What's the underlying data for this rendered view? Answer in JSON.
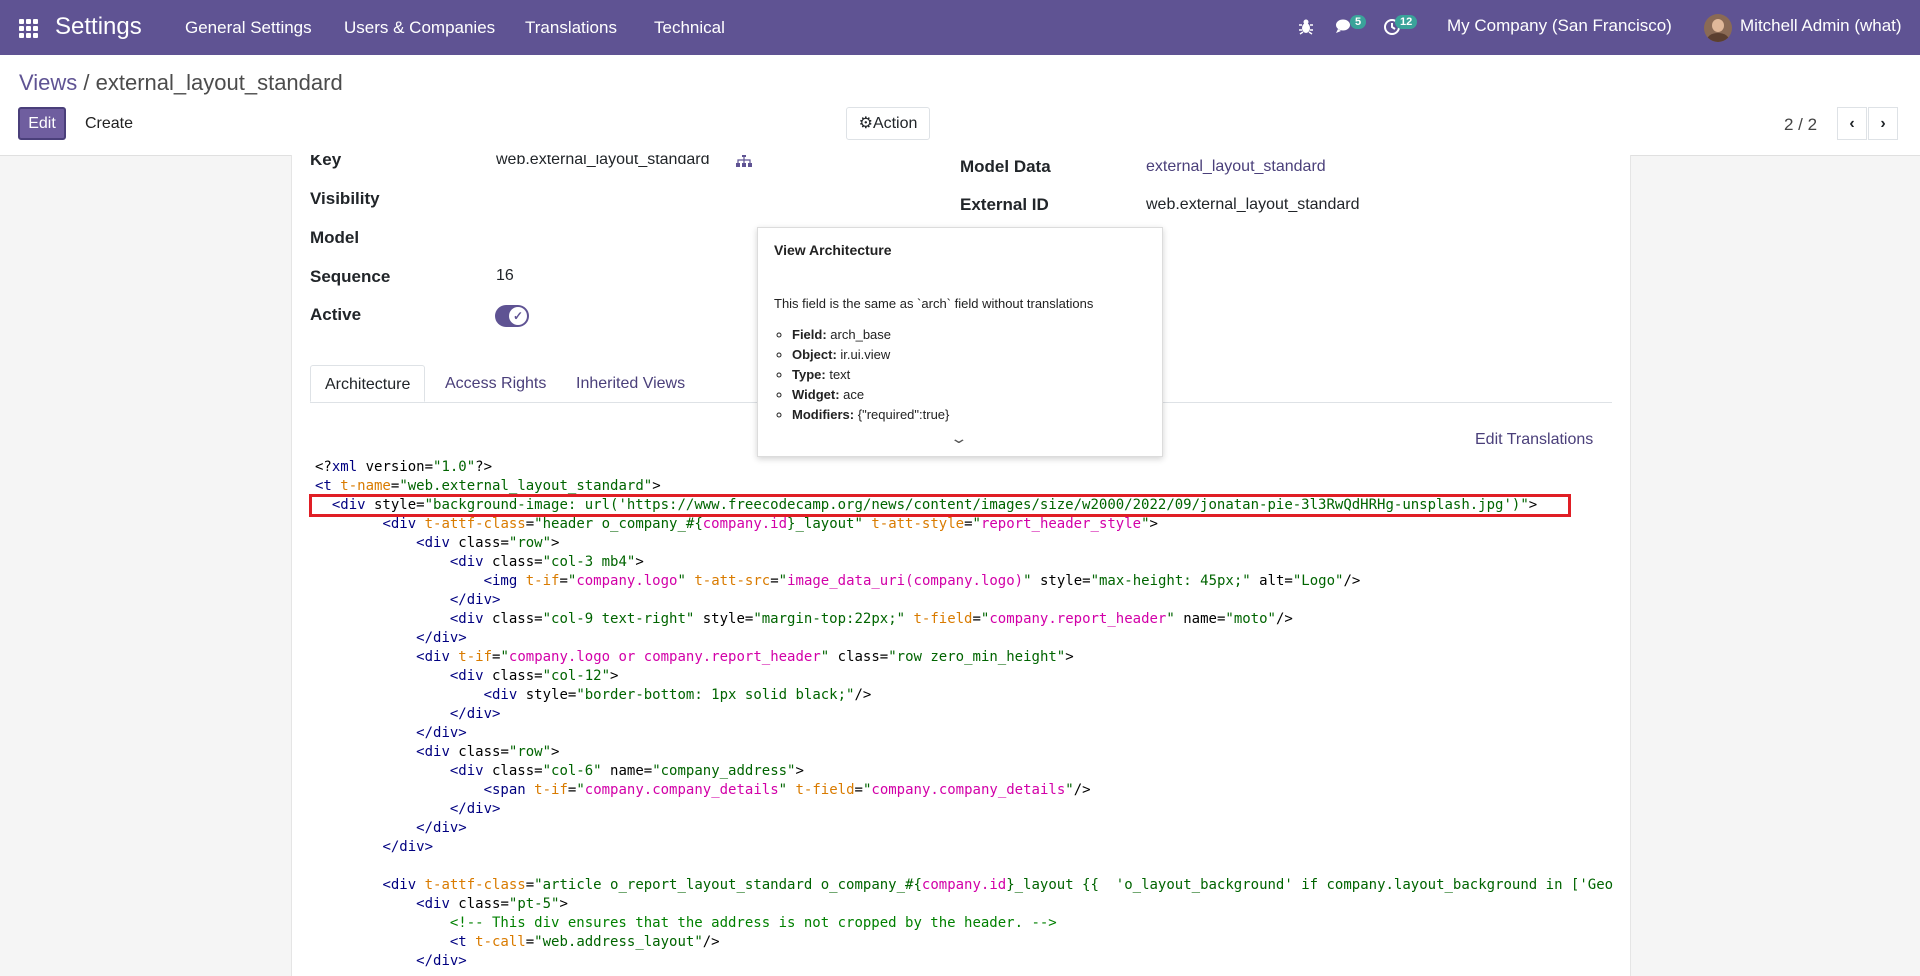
{
  "nav": {
    "brand": "Settings",
    "menu": [
      "General Settings",
      "Users & Companies",
      "Translations",
      "Technical"
    ],
    "messages_count": "5",
    "activities_count": "12",
    "company": "My Company (San Francisco)",
    "user": "Mitchell Admin (what)"
  },
  "control_panel": {
    "breadcrumb_parent": "Views",
    "breadcrumb_separator": " / ",
    "breadcrumb_current": "external_layout_standard",
    "edit_label": "Edit",
    "create_label": "Create",
    "action_label": "Action",
    "pager": "2 / 2"
  },
  "form": {
    "key_label": "Key",
    "key_value": "web.external_layout_standard",
    "visibility_label": "Visibility",
    "model_label": "Model",
    "sequence_label": "Sequence",
    "sequence_value": "16",
    "active_label": "Active",
    "model_data_label": "Model Data",
    "model_data_value": "external_layout_standard",
    "external_id_label": "External ID",
    "external_id_value": "web.external_layout_standard"
  },
  "tabs": [
    "Architecture",
    "Access Rights",
    "Inherited Views"
  ],
  "edit_translations": "Edit Translations",
  "tooltip": {
    "title": "View Architecture",
    "description": "This field is the same as `arch` field without translations",
    "items": [
      {
        "k": "Field:",
        "v": "arch_base"
      },
      {
        "k": "Object:",
        "v": "ir.ui.view"
      },
      {
        "k": "Type:",
        "v": "text"
      },
      {
        "k": "Widget:",
        "v": "ace"
      },
      {
        "k": "Modifiers:",
        "v": "{\"required\":true}"
      }
    ]
  },
  "code_lines": [
    [
      [
        "",
        "<?"
      ],
      [
        "tg",
        "xml"
      ],
      [
        "at",
        " version="
      ],
      [
        "st",
        "\"1.0\""
      ],
      [
        "",
        "?>"
      ]
    ],
    [
      [
        "tg",
        "<t"
      ],
      [
        "ta",
        " t-name"
      ],
      [
        "",
        "="
      ],
      [
        "st",
        "\"web.external_layout_standard\""
      ],
      [
        "",
        ">"
      ]
    ],
    [
      [
        "",
        "  "
      ],
      [
        "tg",
        "<div"
      ],
      [
        "at",
        " style="
      ],
      [
        "st",
        "\"background-image: url('https://www.freecodecamp.org/news/content/images/size/w2000/2022/09/jonatan-pie-3l3RwQdHRHg-unsplash.jpg')\""
      ],
      [
        "",
        ">"
      ]
    ],
    [
      [
        "",
        "        "
      ],
      [
        "tg",
        "<div"
      ],
      [
        "ta",
        " t-attf-class"
      ],
      [
        "",
        "="
      ],
      [
        "st",
        "\"header o_company_#{"
      ],
      [
        "qv",
        "company.id"
      ],
      [
        "st",
        "}_layout\""
      ],
      [
        "ta",
        " t-att-style"
      ],
      [
        "",
        "="
      ],
      [
        "st",
        "\""
      ],
      [
        "qv",
        "report_header_style"
      ],
      [
        "st",
        "\""
      ],
      [
        "",
        ">"
      ]
    ],
    [
      [
        "",
        "            "
      ],
      [
        "tg",
        "<div"
      ],
      [
        "at",
        " class="
      ],
      [
        "st",
        "\"row\""
      ],
      [
        "",
        ">"
      ]
    ],
    [
      [
        "",
        "                "
      ],
      [
        "tg",
        "<div"
      ],
      [
        "at",
        " class="
      ],
      [
        "st",
        "\"col-3 mb4\""
      ],
      [
        "",
        ">"
      ]
    ],
    [
      [
        "",
        "                    "
      ],
      [
        "tg",
        "<img"
      ],
      [
        "ta",
        " t-if"
      ],
      [
        "",
        "="
      ],
      [
        "st",
        "\""
      ],
      [
        "qv",
        "company.logo"
      ],
      [
        "st",
        "\""
      ],
      [
        "ta",
        " t-att-src"
      ],
      [
        "",
        "="
      ],
      [
        "st",
        "\""
      ],
      [
        "qv",
        "image_data_uri(company.logo)"
      ],
      [
        "st",
        "\""
      ],
      [
        "at",
        " style="
      ],
      [
        "st",
        "\"max-height: 45px;\""
      ],
      [
        "at",
        " alt="
      ],
      [
        "st",
        "\"Logo\""
      ],
      [
        "",
        "/>"
      ]
    ],
    [
      [
        "",
        "                "
      ],
      [
        "tg",
        "</div>"
      ]
    ],
    [
      [
        "",
        "                "
      ],
      [
        "tg",
        "<div"
      ],
      [
        "at",
        " class="
      ],
      [
        "st",
        "\"col-9 text-right\""
      ],
      [
        "at",
        " style="
      ],
      [
        "st",
        "\"margin-top:22px;\""
      ],
      [
        "ta",
        " t-field"
      ],
      [
        "",
        "="
      ],
      [
        "st",
        "\""
      ],
      [
        "qv",
        "company.report_header"
      ],
      [
        "st",
        "\""
      ],
      [
        "at",
        " name="
      ],
      [
        "st",
        "\"moto\""
      ],
      [
        "",
        "/>"
      ]
    ],
    [
      [
        "",
        "            "
      ],
      [
        "tg",
        "</div>"
      ]
    ],
    [
      [
        "",
        "            "
      ],
      [
        "tg",
        "<div"
      ],
      [
        "ta",
        " t-if"
      ],
      [
        "",
        "="
      ],
      [
        "st",
        "\""
      ],
      [
        "qv",
        "company.logo or company.report_header"
      ],
      [
        "st",
        "\""
      ],
      [
        "at",
        " class="
      ],
      [
        "st",
        "\"row zero_min_height\""
      ],
      [
        "",
        ">"
      ]
    ],
    [
      [
        "",
        "                "
      ],
      [
        "tg",
        "<div"
      ],
      [
        "at",
        " class="
      ],
      [
        "st",
        "\"col-12\""
      ],
      [
        "",
        ">"
      ]
    ],
    [
      [
        "",
        "                    "
      ],
      [
        "tg",
        "<div"
      ],
      [
        "at",
        " style="
      ],
      [
        "st",
        "\"border-bottom: 1px solid black;\""
      ],
      [
        "",
        "/>"
      ]
    ],
    [
      [
        "",
        "                "
      ],
      [
        "tg",
        "</div>"
      ]
    ],
    [
      [
        "",
        "            "
      ],
      [
        "tg",
        "</div>"
      ]
    ],
    [
      [
        "",
        "            "
      ],
      [
        "tg",
        "<div"
      ],
      [
        "at",
        " class="
      ],
      [
        "st",
        "\"row\""
      ],
      [
        "",
        ">"
      ]
    ],
    [
      [
        "",
        "                "
      ],
      [
        "tg",
        "<div"
      ],
      [
        "at",
        " class="
      ],
      [
        "st",
        "\"col-6\""
      ],
      [
        "at",
        " name="
      ],
      [
        "st",
        "\"company_address\""
      ],
      [
        "",
        ">"
      ]
    ],
    [
      [
        "",
        "                    "
      ],
      [
        "tg",
        "<span"
      ],
      [
        "ta",
        " t-if"
      ],
      [
        "",
        "="
      ],
      [
        "st",
        "\""
      ],
      [
        "qv",
        "company.company_details"
      ],
      [
        "st",
        "\""
      ],
      [
        "ta",
        " t-field"
      ],
      [
        "",
        "="
      ],
      [
        "st",
        "\""
      ],
      [
        "qv",
        "company.company_details"
      ],
      [
        "st",
        "\""
      ],
      [
        "",
        "/>"
      ]
    ],
    [
      [
        "",
        "                "
      ],
      [
        "tg",
        "</div>"
      ]
    ],
    [
      [
        "",
        "            "
      ],
      [
        "tg",
        "</div>"
      ]
    ],
    [
      [
        "",
        "        "
      ],
      [
        "tg",
        "</div>"
      ]
    ],
    [
      [
        "",
        ""
      ]
    ],
    [
      [
        "",
        "        "
      ],
      [
        "tg",
        "<div"
      ],
      [
        "ta",
        " t-attf-class"
      ],
      [
        "",
        "="
      ],
      [
        "st",
        "\"article o_report_layout_standard o_company_#{"
      ],
      [
        "qv",
        "company.id"
      ],
      [
        "st",
        "}_layout {{  'o_layout_background' if company.layout_background in ['Geo"
      ]
    ],
    [
      [
        "",
        "            "
      ],
      [
        "tg",
        "<div"
      ],
      [
        "at",
        " class="
      ],
      [
        "st",
        "\"pt-5\""
      ],
      [
        "",
        ">"
      ]
    ],
    [
      [
        "",
        "                "
      ],
      [
        "cm",
        "<!-- This div ensures that the address is not cropped by the header. -->"
      ]
    ],
    [
      [
        "",
        "                "
      ],
      [
        "tg",
        "<t"
      ],
      [
        "ta",
        " t-call"
      ],
      [
        "",
        "="
      ],
      [
        "st",
        "\"web.address_layout\""
      ],
      [
        "",
        "/>"
      ]
    ],
    [
      [
        "",
        "            "
      ],
      [
        "tg",
        "</div>"
      ]
    ]
  ]
}
